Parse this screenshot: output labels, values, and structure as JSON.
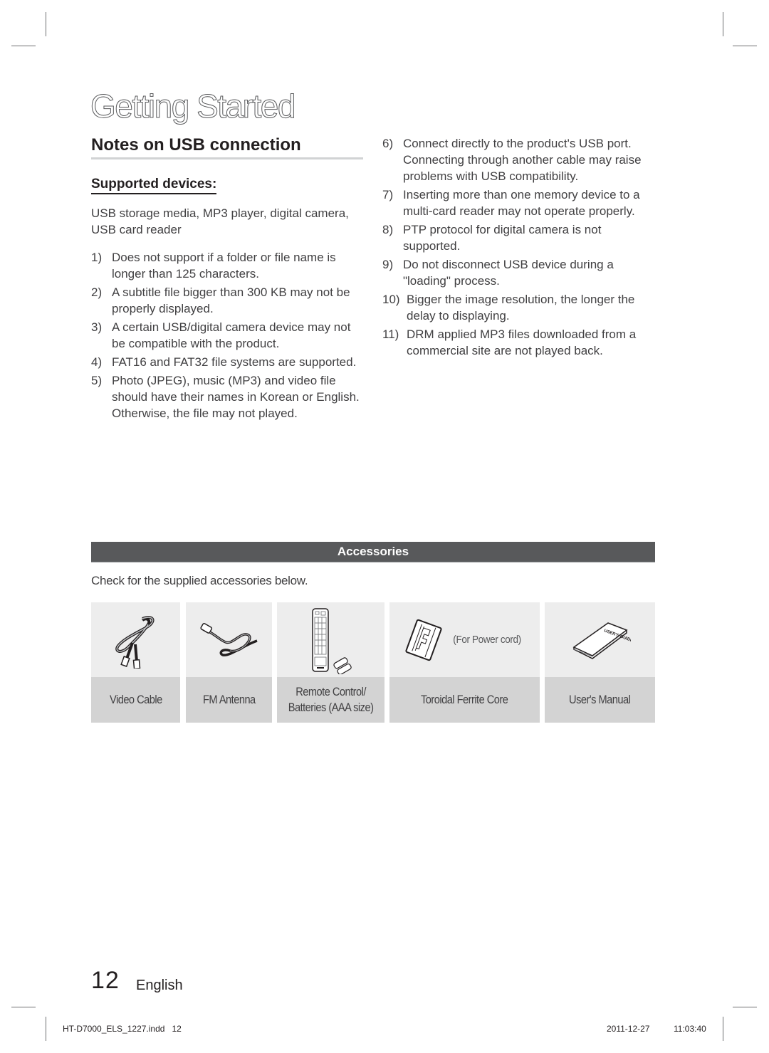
{
  "header": {
    "chapter_title": "Getting Started"
  },
  "usb_notes": {
    "section_title": "Notes on USB connection",
    "subsection_title": "Supported devices:",
    "intro": "USB storage media, MP3 player, digital camera, USB card reader",
    "items": [
      {
        "num": "1)",
        "text": "Does not support if a folder or file name is longer than 125 characters."
      },
      {
        "num": "2)",
        "text": "A subtitle file bigger than 300 KB may not be properly displayed."
      },
      {
        "num": "3)",
        "text": "A certain USB/digital camera device may not be compatible with the product."
      },
      {
        "num": "4)",
        "text": "FAT16 and FAT32 file systems are supported."
      },
      {
        "num": "5)",
        "text": "Photo (JPEG), music (MP3) and video file should have their names in Korean or English. Otherwise, the file may not played."
      },
      {
        "num": "6)",
        "text": "Connect directly to the product's USB port. Connecting through another cable may raise problems with USB compatibility."
      },
      {
        "num": "7)",
        "text": "Inserting more than one memory device to a multi-card reader may not operate properly."
      },
      {
        "num": "8)",
        "text": "PTP protocol for digital camera is not supported."
      },
      {
        "num": "9)",
        "text": "Do not disconnect USB device during a \"loading\" process."
      },
      {
        "num": "10)",
        "text": "Bigger the image resolution, the longer the delay to displaying."
      },
      {
        "num": "11)",
        "text": "DRM applied MP3 files downloaded from a commercial site are not played back."
      }
    ]
  },
  "accessories": {
    "title": "Accessories",
    "intro": "Check for the supplied accessories below.",
    "items": [
      {
        "icon": "video-cable-icon",
        "label_line1": "Video Cable",
        "label_line2": ""
      },
      {
        "icon": "fm-antenna-icon",
        "label_line1": "FM Antenna",
        "label_line2": ""
      },
      {
        "icon": "remote-control-icon",
        "label_line1": "Remote Control/",
        "label_line2": "Batteries (AAA size)"
      },
      {
        "icon": "ferrite-core-icon",
        "label_line1": "Toroidal Ferrite Core",
        "label_line2": "",
        "note": "(For Power cord)"
      },
      {
        "icon": "users-manual-icon",
        "label_line1": "User's Manual",
        "label_line2": ""
      }
    ]
  },
  "footer": {
    "page_number": "12",
    "language": "English",
    "slug_file": "HT-D7000_ELS_1227.indd   12",
    "slug_date": "2011-12-27",
    "slug_time": "11:03:40"
  }
}
